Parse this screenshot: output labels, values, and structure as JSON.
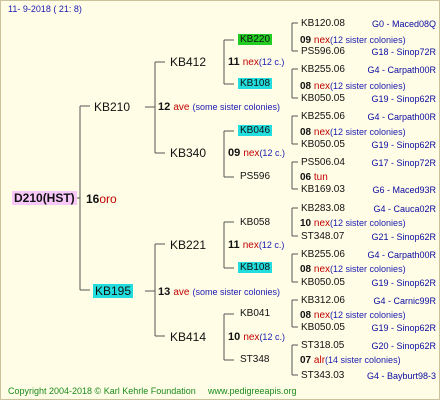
{
  "header": {
    "date": "11- 9-2018 ( 21: 8)"
  },
  "footer": {
    "copyright": "Copyright 2004-2018 © Karl Kehrle Foundation",
    "url": "www.pedigreeapis.org"
  },
  "root": {
    "name": "D210(HST)",
    "num": "16",
    "stat": "oro"
  },
  "gen1": {
    "upper": {
      "name": "KB210",
      "num": "12",
      "stat": "ave",
      "note": "(some sister colonies)"
    },
    "lower": {
      "name": "KB195",
      "num": "13",
      "stat": "ave",
      "note": "(some sister colonies)"
    }
  },
  "gen2": [
    {
      "name": "KB412",
      "num": "11",
      "stat": "nex",
      "note": "(12 c.)"
    },
    {
      "name": "KB340",
      "num": "09",
      "stat": "nex",
      "note": "(12 c.)"
    },
    {
      "name": "KB221",
      "num": "11",
      "stat": "nex",
      "note": "(12 c.)"
    },
    {
      "name": "KB414",
      "num": "10",
      "stat": "nex",
      "note": "(12 c.)"
    }
  ],
  "gen3": [
    {
      "name": "KB220",
      "num": "09",
      "stat": "nex",
      "note": "(12 sister colonies)"
    },
    {
      "name": "KB108",
      "num": "08",
      "stat": "nex",
      "note": "(12 sister colonies)"
    },
    {
      "name": "KB046",
      "num": "08",
      "stat": "nex",
      "note": "(12 sister colonies)"
    },
    {
      "name": "PS596",
      "num": "06",
      "stat": "tun",
      "note": ""
    },
    {
      "name": "KB058",
      "num": "10",
      "stat": "nex",
      "note": "(12 sister colonies)"
    },
    {
      "name": "KB108",
      "num": "08",
      "stat": "nex",
      "note": "(12 sister colonies)"
    },
    {
      "name": "KB041",
      "num": "08",
      "stat": "nex",
      "note": "(12 sister colonies)"
    },
    {
      "name": "ST348",
      "num": "07",
      "stat": "alr",
      "note": "(14 sister colonies)"
    }
  ],
  "gen4": [
    {
      "name": "KB120.08",
      "code": "G0 - Maced08Q"
    },
    {
      "name": "PS596.06",
      "code": "G18 - Sinop72R"
    },
    {
      "name": "KB255.06",
      "code": "G4 - Carpath00R"
    },
    {
      "name": "KB050.05",
      "code": "G19 - Sinop62R"
    },
    {
      "name": "KB255.06",
      "code": "G4 - Carpath00R"
    },
    {
      "name": "KB050.05",
      "code": "G19 - Sinop62R"
    },
    {
      "name": "PS506.04",
      "code": "G17 - Sinop72R"
    },
    {
      "name": "KB169.03",
      "code": "G6 - Maced93R"
    },
    {
      "name": "KB283.08",
      "code": "G4 - Cauca02R"
    },
    {
      "name": "ST348.07",
      "code": "G21 - Sinop62R"
    },
    {
      "name": "KB255.06",
      "code": "G4 - Carpath00R"
    },
    {
      "name": "KB050.05",
      "code": "G19 - Sinop62R"
    },
    {
      "name": "KB312.06",
      "code": "G4 - Carnic99R"
    },
    {
      "name": "KB050.05",
      "code": "G19 - Sinop62R"
    },
    {
      "name": "ST318.05",
      "code": "G20 - Sinop62R"
    },
    {
      "name": "ST343.03",
      "code": "G4 - Bayburt98-3"
    }
  ],
  "colors": {
    "background": "#fffde6",
    "highlight_green": "#22cc22",
    "highlight_cyan": "#22dddd",
    "status_red": "#c00000",
    "link_blue": "#1a1ab0",
    "footer_green": "#1a8a1a"
  }
}
